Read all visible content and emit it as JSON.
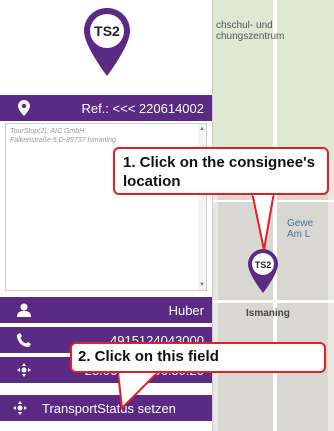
{
  "tour_stop": {
    "pin_label": "TS2",
    "reference": "Ref.: <<< 220614002",
    "info_line1": "TourStop(2): AIC GmbH",
    "info_line2": "Falkenstraße 5,D-85737 Ismaning"
  },
  "fields": {
    "name": "Huber",
    "phone": "4915124043000",
    "datetime": "28.06.2022 06:59:20",
    "transport_status": "TransportStatus setzen"
  },
  "map": {
    "label_top1": "chschul- und",
    "label_top2": "chungszentrum",
    "label_gew1": "Gewe",
    "label_gew2": "Am L",
    "label_ismaning": "Ismaning",
    "pin_label": "TS2"
  },
  "callouts": {
    "step1": "1. Click on the consignee's location",
    "step2": "2. Click on this field"
  },
  "colors": {
    "brand_purple": "#5a2a84",
    "callout_red": "#e31e24"
  }
}
